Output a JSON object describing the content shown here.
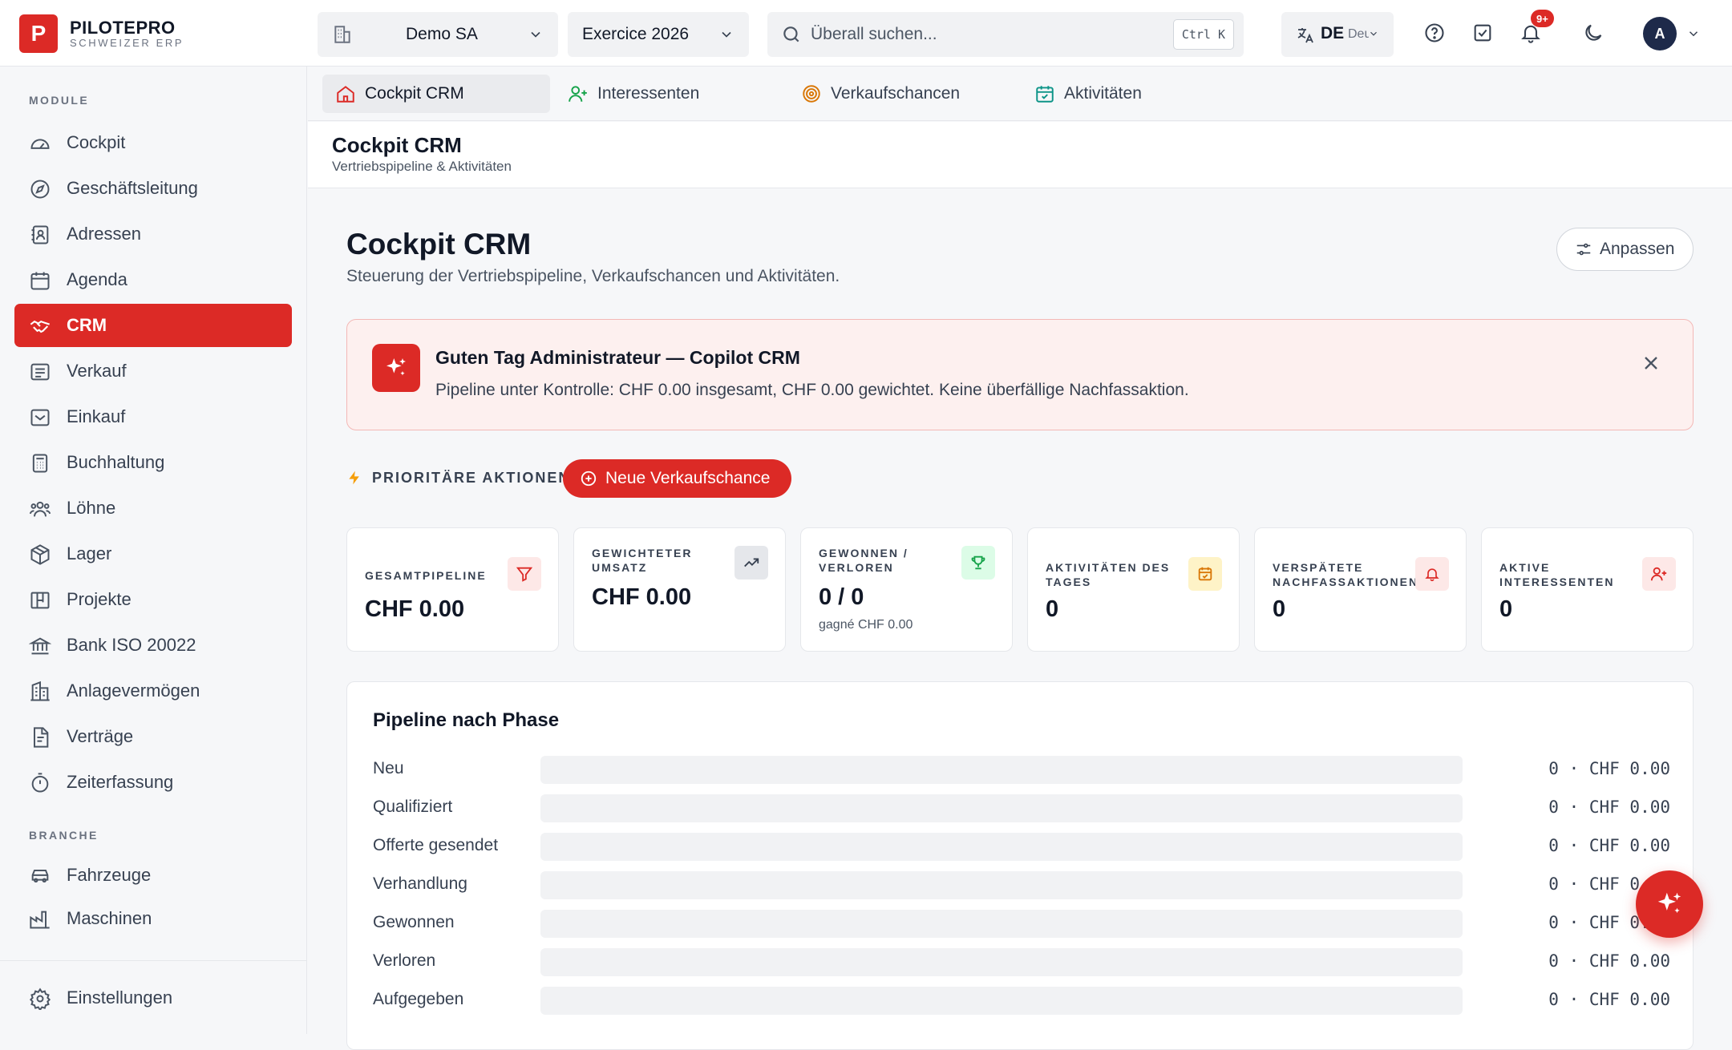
{
  "brand": {
    "name": "PILOTEPRO",
    "subtitle": "SCHWEIZER ERP",
    "logo_letter": "P"
  },
  "header": {
    "company": "Demo SA",
    "fiscal_year": "Exercice 2026",
    "search_placeholder": "Überall suchen...",
    "search_shortcut": "Ctrl K",
    "language": "DE",
    "language_name": "Deutsch",
    "notification_count": "9+",
    "avatar_initial": "A"
  },
  "sidebar": {
    "modules_title": "MODULE",
    "items": [
      {
        "label": "Cockpit",
        "icon": "gauge-icon"
      },
      {
        "label": "Geschäftsleitung",
        "icon": "compass-icon"
      },
      {
        "label": "Adressen",
        "icon": "contact-book-icon"
      },
      {
        "label": "Agenda",
        "icon": "calendar-icon"
      },
      {
        "label": "CRM",
        "icon": "handshake-icon",
        "active": true
      },
      {
        "label": "Verkauf",
        "icon": "receipt-icon"
      },
      {
        "label": "Einkauf",
        "icon": "inbox-icon"
      },
      {
        "label": "Buchhaltung",
        "icon": "calculator-icon"
      },
      {
        "label": "Löhne",
        "icon": "users-icon"
      },
      {
        "label": "Lager",
        "icon": "package-icon"
      },
      {
        "label": "Projekte",
        "icon": "kanban-icon"
      },
      {
        "label": "Bank ISO 20022",
        "icon": "bank-icon"
      },
      {
        "label": "Anlagevermögen",
        "icon": "building-icon"
      },
      {
        "label": "Verträge",
        "icon": "file-contract-icon"
      },
      {
        "label": "Zeiterfassung",
        "icon": "stopwatch-icon"
      }
    ],
    "industry_title": "BRANCHE",
    "industry_items": [
      {
        "label": "Fahrzeuge",
        "icon": "car-icon"
      },
      {
        "label": "Maschinen",
        "icon": "factory-icon"
      }
    ],
    "settings_label": "Einstellungen"
  },
  "tabs": [
    {
      "label": "Cockpit CRM",
      "icon": "home-icon",
      "active": true
    },
    {
      "label": "Interessenten",
      "icon": "user-plus-icon"
    },
    {
      "label": "Verkaufschancen",
      "icon": "target-icon"
    },
    {
      "label": "Aktivitäten",
      "icon": "calendar-check-icon"
    }
  ],
  "titlebar": {
    "title": "Cockpit CRM",
    "subtitle": "Vertriebspipeline & Aktivitäten"
  },
  "page": {
    "title": "Cockpit CRM",
    "subtitle": "Steuerung der Vertriebspipeline, Verkaufschancen und Aktivitäten.",
    "adjust_label": "Anpassen"
  },
  "copilot": {
    "title": "Guten Tag Administrateur — Copilot CRM",
    "message": "Pipeline unter Kontrolle: CHF 0.00 insgesamt, CHF 0.00 gewichtet. Keine überfällige Nachfassaktion."
  },
  "priority": {
    "label": "PRIORITÄRE AKTIONEN",
    "button": "Neue Verkaufschance"
  },
  "kpis": [
    {
      "label": "GESAMTPIPELINE",
      "value": "CHF 0.00",
      "icon": "funnel-icon",
      "color": "#dc2a26"
    },
    {
      "label": "GEWICHTETER UMSATZ",
      "value": "CHF 0.00",
      "icon": "trending-up-icon",
      "color": "#374151"
    },
    {
      "label": "GEWONNEN / VERLOREN",
      "value": "0 / 0",
      "sub": "gagné CHF 0.00",
      "icon": "trophy-icon",
      "color": "#16a34a"
    },
    {
      "label": "AKTIVITÄTEN DES TAGES",
      "value": "0",
      "icon": "calendar-check-icon",
      "color": "#d97706"
    },
    {
      "label": "VERSPÄTETE NACHFASSAKTIONEN",
      "value": "0",
      "icon": "bell-icon",
      "color": "#dc2a26"
    },
    {
      "label": "AKTIVE INTERESSENTEN",
      "value": "0",
      "icon": "user-plus-icon",
      "color": "#dc2a26"
    }
  ],
  "pipeline": {
    "title": "Pipeline nach Phase",
    "rows": [
      {
        "label": "Neu",
        "value": "0 · CHF 0.00"
      },
      {
        "label": "Qualifiziert",
        "value": "0 · CHF 0.00"
      },
      {
        "label": "Offerte gesendet",
        "value": "0 · CHF 0.00"
      },
      {
        "label": "Verhandlung",
        "value": "0 · CHF 0.00"
      },
      {
        "label": "Gewonnen",
        "value": "0 · CHF 0.00"
      },
      {
        "label": "Verloren",
        "value": "0 · CHF 0.00"
      },
      {
        "label": "Aufgegeben",
        "value": "0 · CHF 0.00"
      }
    ]
  },
  "colors": {
    "accent": "#dc2a26",
    "accent_soft": "#fdf0ef",
    "border": "#e5e7eb"
  }
}
